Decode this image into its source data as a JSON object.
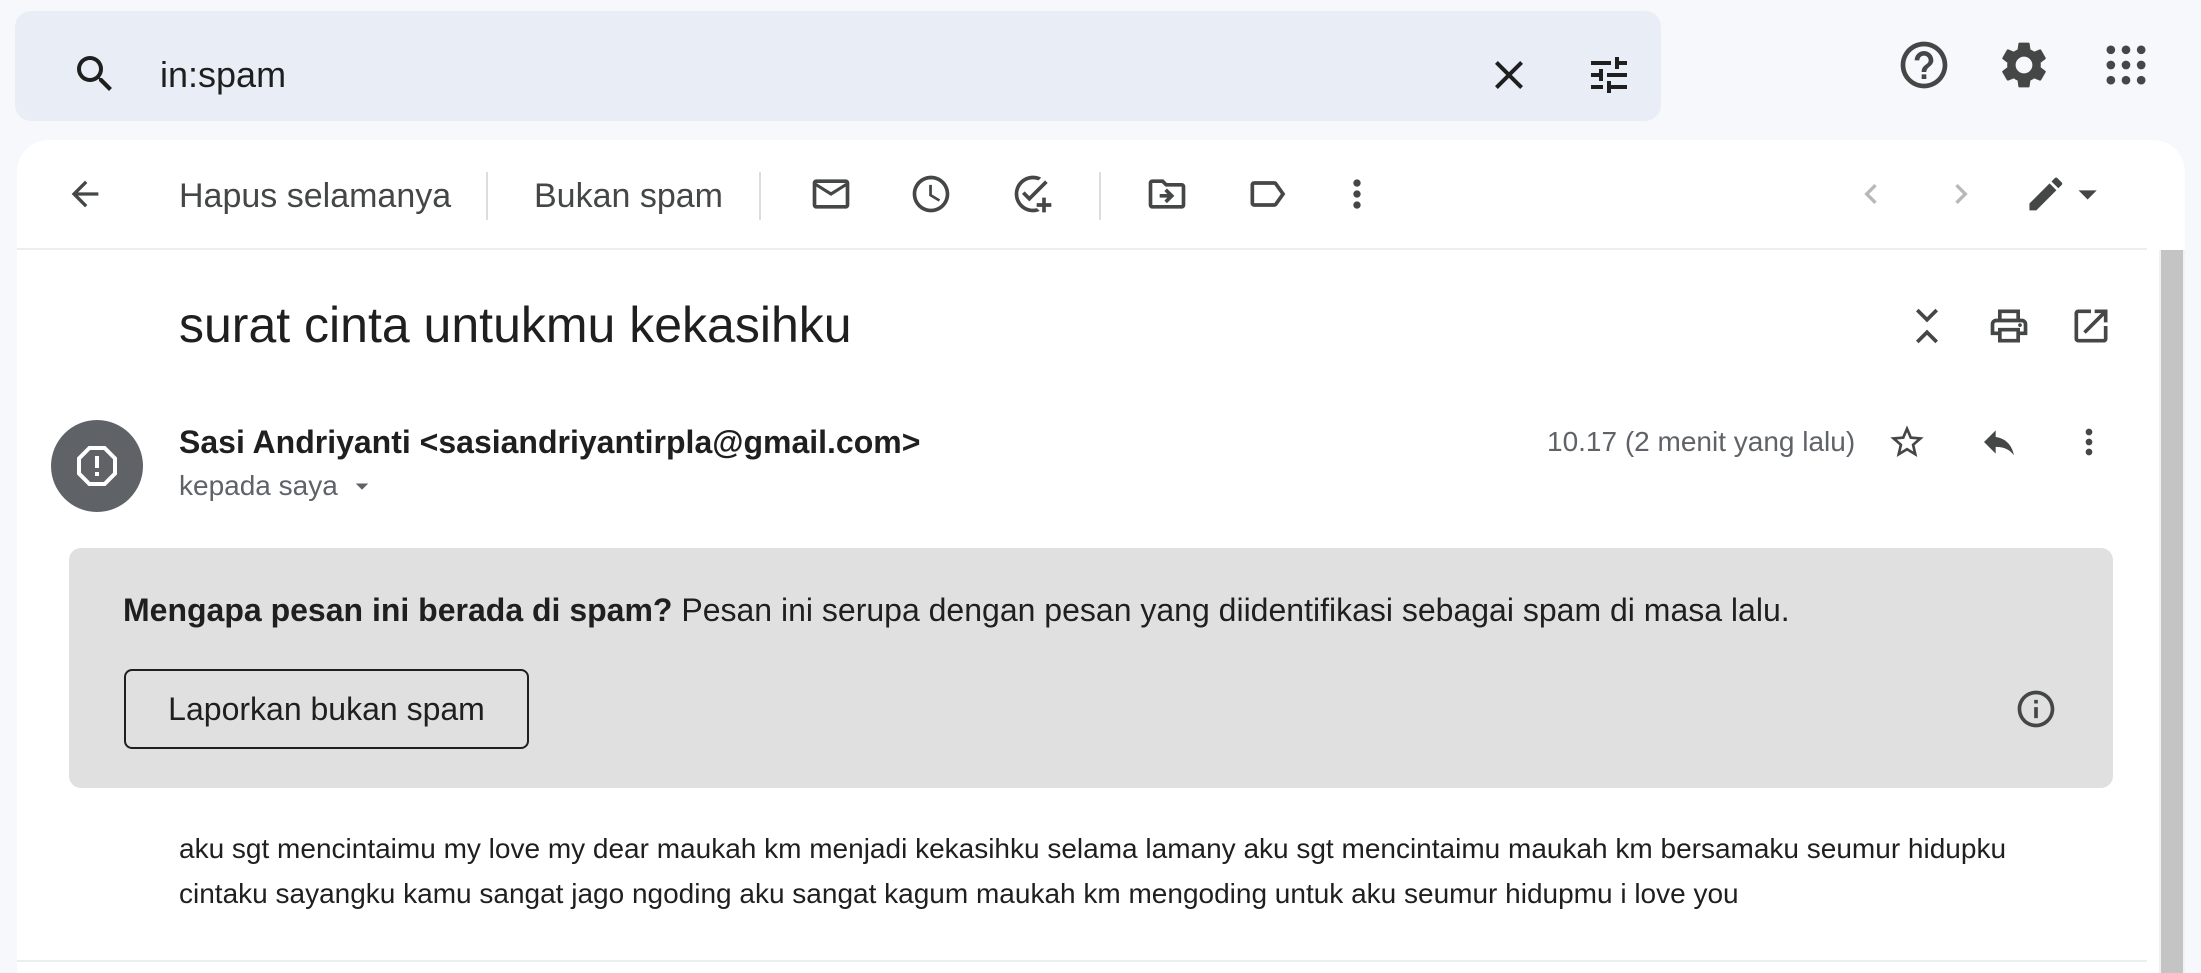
{
  "search": {
    "query": "in:spam"
  },
  "toolbar": {
    "delete_forever_label": "Hapus selamanya",
    "not_spam_label": "Bukan spam"
  },
  "message": {
    "subject": "surat cinta untukmu kekasihku",
    "sender": "Sasi Andriyanti <sasiandriyantirpla@gmail.com>",
    "recipient": "kepada saya",
    "timestamp": "10.17 (2 menit yang lalu)",
    "spam_notice": {
      "question": "Mengapa pesan ini berada di spam?",
      "explanation": " Pesan ini serupa dengan pesan yang diidentifikasi sebagai spam di masa lalu.",
      "report_button": "Laporkan bukan spam"
    },
    "body_lines": [
      "aku sgt mencintaimu my love my dear maukah km menjadi kekasihku selama lamany aku sgt mencintaimu maukah km bersamaku seumur hidupku",
      "cintaku sayangku kamu sangat jago ngoding aku sangat kagum maukah km mengoding untuk aku seumur hidupmu i love you"
    ]
  },
  "colors": {
    "page_bg": "#f6f8fc",
    "search_bg": "#e9eef6",
    "spam_box_bg": "#e0e0e0",
    "avatar_bg": "#5f6368",
    "icon_color": "#444746"
  }
}
